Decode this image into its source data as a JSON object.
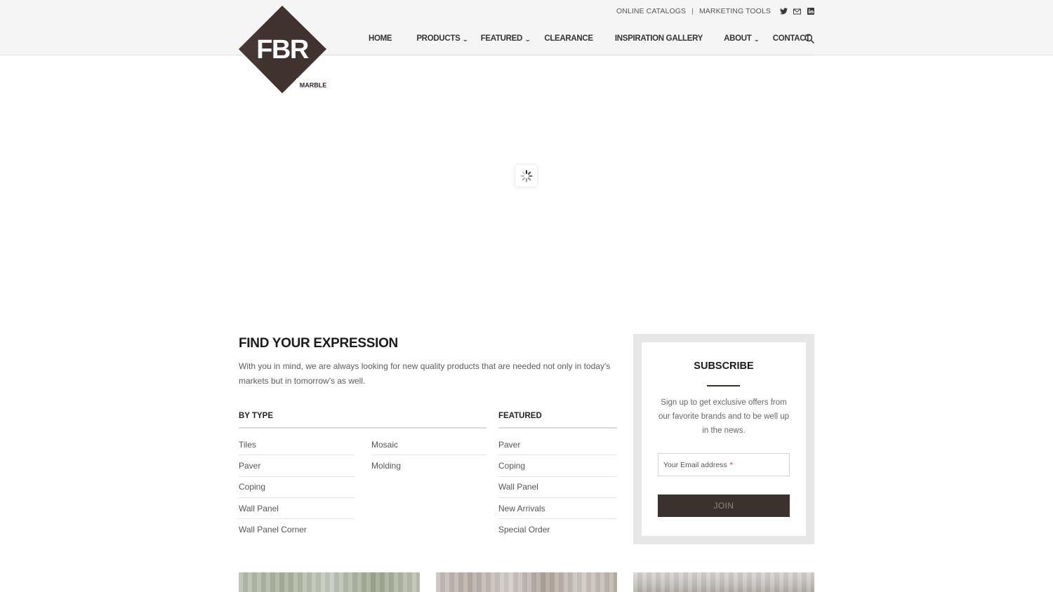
{
  "brand": {
    "logo_text": "FBR",
    "logo_subtext": "MARBLE"
  },
  "topbar": {
    "online_catalogs": "ONLINE CATALOGS",
    "separator": "|",
    "marketing_tools": "MARKETING TOOLS",
    "social_icons": [
      "twitter-icon",
      "mail-icon",
      "linkedin-icon"
    ]
  },
  "nav": {
    "items": [
      {
        "label": "HOME"
      },
      {
        "label": "PRODUCTS"
      },
      {
        "label": "FEATURED"
      },
      {
        "label": "CLEARANCE"
      },
      {
        "label": "INSPIRATION GALLERY"
      },
      {
        "label": "ABOUT"
      },
      {
        "label": "CONTACT"
      }
    ],
    "search_icon": "search-icon"
  },
  "hero": {
    "loading_icon": "spinner-icon"
  },
  "intro": {
    "title": "FIND YOUR EXPRESSION",
    "text": "With you in mind, we are always looking for new quality products that are needed not only in today's markets but in tomorrow's as well."
  },
  "by_type": {
    "heading": "BY TYPE",
    "col1": [
      "Tiles",
      "Paver",
      "Coping",
      "Wall Panel",
      "Wall Panel Corner"
    ],
    "col2": [
      "Mosaic",
      "Molding"
    ]
  },
  "featured": {
    "heading": "FEATURED",
    "items": [
      "Paver",
      "Coping",
      "Wall Panel",
      "New Arrivals",
      "Special Order"
    ]
  },
  "subscribe": {
    "title": "SUBSCRIBE",
    "text": "Sign up to get exclusive offers from our favorite brands and to be well up in the news.",
    "email_placeholder": "Your Email address",
    "required_mark": "*",
    "join_label": "JOIN"
  },
  "colors": {
    "brand_dark": "#3b3230",
    "header_bg": "#f5f5f5",
    "subscribe_frame": "#e7e7e7"
  }
}
